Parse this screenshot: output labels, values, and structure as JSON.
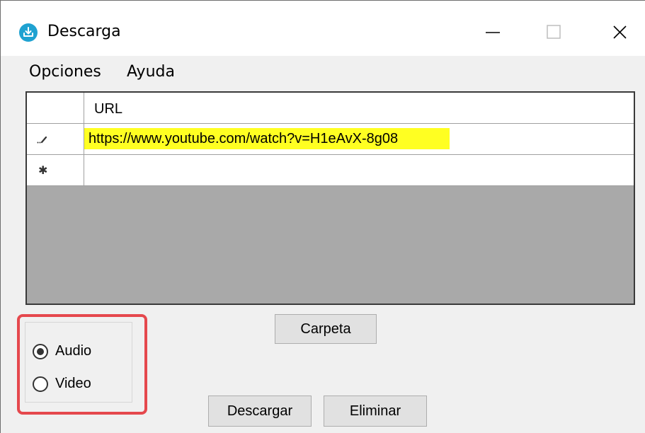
{
  "window": {
    "title": "Descarga"
  },
  "menu": {
    "items": [
      "Opciones",
      "Ayuda"
    ]
  },
  "grid": {
    "column_header": "URL",
    "rows": [
      {
        "url": "https://www.youtube.com/watch?v=H1eAvX-8g08"
      }
    ]
  },
  "buttons": {
    "carpeta": "Carpeta",
    "descargar": "Descargar",
    "eliminar": "Eliminar"
  },
  "format": {
    "options": [
      "Audio",
      "Video"
    ],
    "selected": "Audio"
  },
  "colors": {
    "app_icon": "#1fa2d1",
    "url_highlight": "#ffff22",
    "annotation_box": "#e5484d",
    "grid_empty_area": "#a9a9a9"
  },
  "icons": {
    "app": "download-app-icon",
    "minimize": "minimize-icon",
    "maximize": "maximize-icon",
    "close": "close-icon",
    "editing_row": "pencil-icon",
    "new_row": "asterisk-icon"
  }
}
